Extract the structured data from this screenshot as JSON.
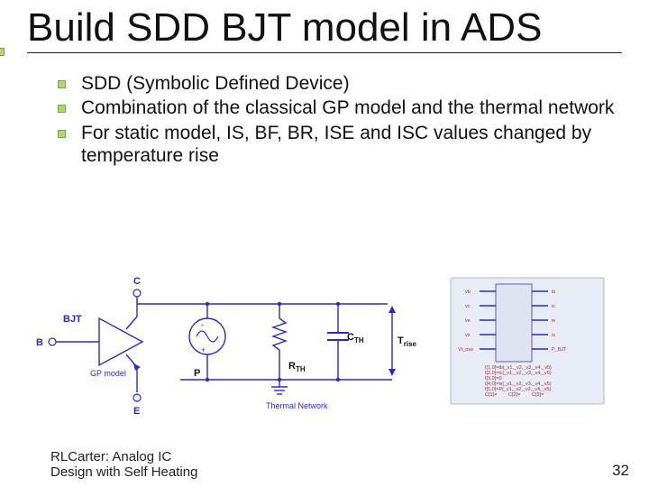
{
  "title": "Build SDD BJT model in ADS",
  "bullets": [
    "SDD (Symbolic Defined Device)",
    "Combination of the classical GP model and the thermal network",
    "For static model, IS, BF, BR, ISE and ISC values changed by temperature rise"
  ],
  "diagram": {
    "bjt_label": "BJT",
    "gp_label": "GP model",
    "terminal_B": "B",
    "terminal_C": "C",
    "terminal_E": "E",
    "source_P": "P",
    "rth": "R",
    "rth_sub": "TH",
    "cth": "C",
    "cth_sub": "TH",
    "trise": "T",
    "trise_sub": "rise",
    "thermal_label": "Thermal Network",
    "sdd_pins_left": [
      "vb",
      "vc",
      "ve",
      "vs",
      "Vt_rise"
    ],
    "sdd_pins_right": [
      "ib",
      "ic",
      "ie",
      "is",
      "P_BJT"
    ],
    "sdd_eqs": [
      "I[1,0]=ib(_v1,_v2,_v3,_v4,_v5)",
      "I[2,0]=ic(_v1,_v2,_v3,_v4,_v5)",
      "I[3,0]=0",
      "I[4,0]=is(_v1,_v2,_v3,_v4,_v5)",
      "I[5,0]=P(_v1,_v2,_v3,_v4,_v5)",
      "C[1]=",
      "C[2]=",
      "C[3]="
    ]
  },
  "footer": "RLCarter: Analog IC Design with Self Heating",
  "page": "32"
}
